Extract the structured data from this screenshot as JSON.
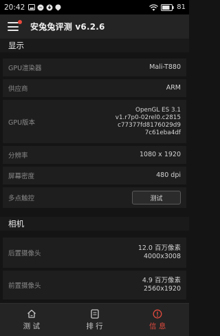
{
  "status_bar": {
    "time": "20:42",
    "battery": "81"
  },
  "app_bar": {
    "title": "安兔兔评测 v6.2.6"
  },
  "sections": {
    "display": {
      "title": "显示",
      "gpu_renderer": {
        "label": "GPU渲染器",
        "value": "Mali-T880"
      },
      "vendor": {
        "label": "供应商",
        "value": "ARM"
      },
      "gpu_version": {
        "label": "GPU版本",
        "lines": [
          "OpenGL ES 3.1",
          "v1.r7p0-02rel0.c2815",
          "c77377fd8176029d9",
          "7c61eba4df"
        ]
      },
      "resolution": {
        "label": "分辨率",
        "value": "1080 x 1920"
      },
      "density": {
        "label": "屏幕密度",
        "value": "480 dpi"
      },
      "multitouch": {
        "label": "多点触控",
        "button": "测试"
      }
    },
    "camera": {
      "title": "相机",
      "rear": {
        "label": "后置摄像头",
        "lines": [
          "12.0 百万像素",
          "4000x3008"
        ]
      },
      "front": {
        "label": "前置摄像头",
        "lines": [
          "4.9 百万像素",
          "2560x1920"
        ]
      }
    }
  },
  "bottom_nav": {
    "items": [
      {
        "label": "测 试",
        "icon": "home-icon"
      },
      {
        "label": "排 行",
        "icon": "document-icon"
      },
      {
        "label": "信 息",
        "icon": "info-icon"
      }
    ],
    "active": 2
  },
  "colors": {
    "accent": "#e04b3f",
    "background": "#141414",
    "row": "#1e1e1e",
    "app_bar": "#242424"
  }
}
